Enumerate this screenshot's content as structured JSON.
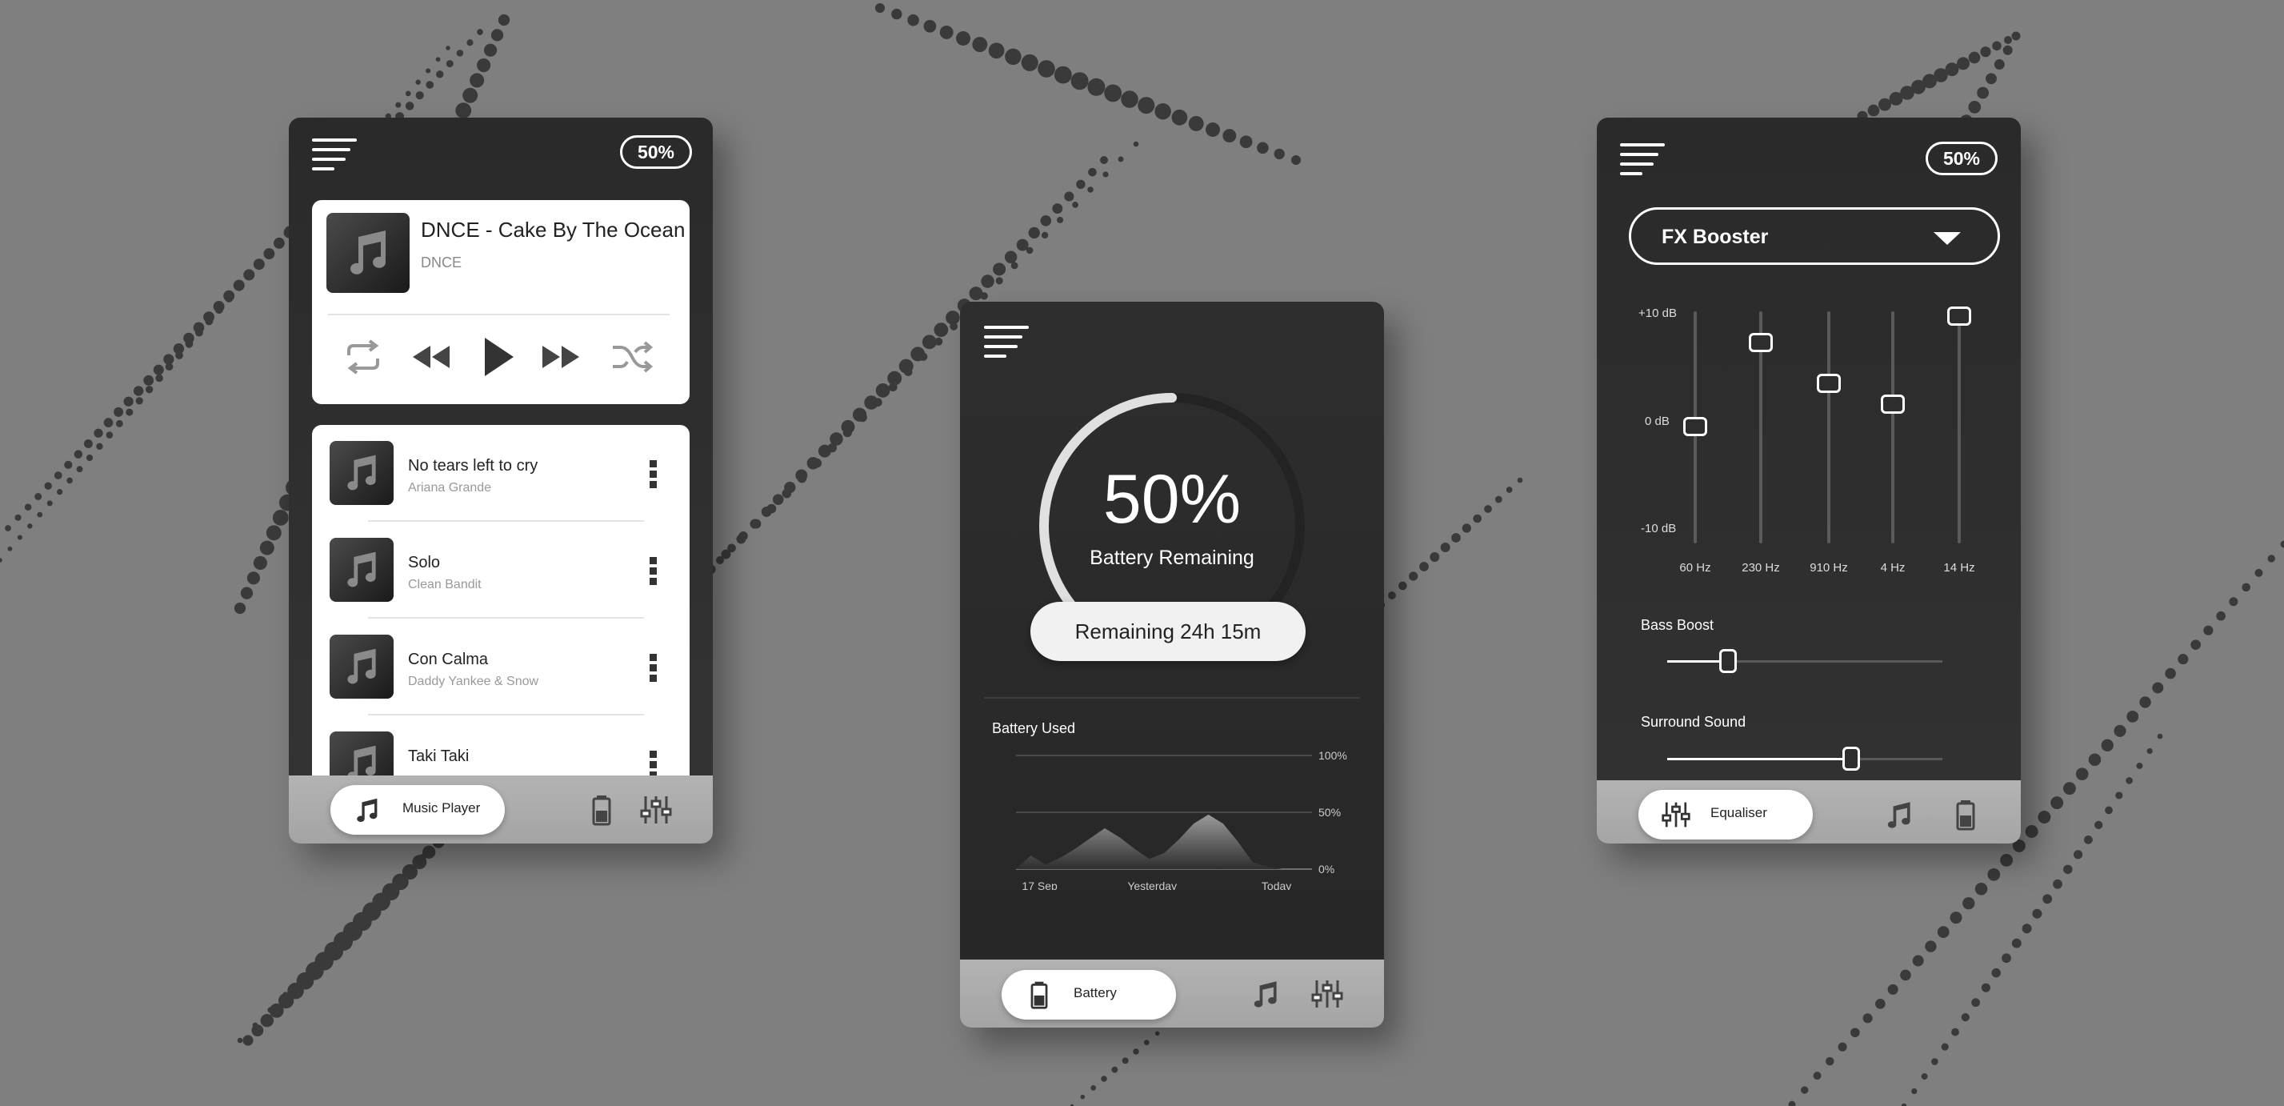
{
  "colors": {
    "background": "#7f7f7f",
    "phone_dark": "#2c2c2c",
    "bottom_bar": "#aaaaaa",
    "accent": "#ffffff"
  },
  "music_screen": {
    "battery_pill": "50%",
    "now_playing": {
      "title": "DNCE - Cake By The Ocean",
      "artist": "DNCE",
      "controls": [
        "repeat-icon",
        "rewind-icon",
        "play-icon",
        "fast-forward-icon",
        "shuffle-icon"
      ]
    },
    "tracks": [
      {
        "title": "No tears left to cry",
        "artist": "Ariana Grande"
      },
      {
        "title": "Solo",
        "artist": "Clean Bandit"
      },
      {
        "title": "Con Calma",
        "artist": "Daddy Yankee & Snow"
      },
      {
        "title": "Taki Taki",
        "artist": ""
      }
    ],
    "bottom_nav": {
      "active_label": "Music Player",
      "active_icon": "music-note-icon",
      "others": [
        "battery-icon",
        "equaliser-icon"
      ]
    }
  },
  "battery_screen": {
    "gauge_percent": "50%",
    "gauge_label": "Battery Remaining",
    "gauge_fraction": 0.5,
    "remaining_text": "Remaining 24h 15m",
    "chart_title": "Battery Used",
    "bottom_nav": {
      "active_label": "Battery",
      "active_icon": "battery-icon",
      "others": [
        "music-note-icon",
        "equaliser-icon"
      ]
    }
  },
  "chart_data": {
    "type": "area",
    "title": "Battery Used",
    "x_tick_labels": [
      "17 Sep",
      "Yesterday",
      "Today"
    ],
    "y_tick_labels": [
      "100%",
      "50%",
      "0%"
    ],
    "ylim": [
      0,
      100
    ],
    "x": [
      0,
      0.5,
      1,
      1.5,
      2,
      2.5,
      3,
      3.5,
      4,
      4.5,
      5,
      5.5,
      6,
      6.5,
      7,
      7.5,
      8,
      8.5,
      9,
      9.5,
      10
    ],
    "values": [
      0,
      12,
      4,
      10,
      18,
      27,
      36,
      28,
      18,
      9,
      14,
      26,
      40,
      48,
      40,
      24,
      6,
      2,
      0,
      0,
      0
    ],
    "grid": true
  },
  "eq_screen": {
    "battery_pill": "50%",
    "preset": "FX Booster",
    "db_labels": [
      "+10 dB",
      "0 dB",
      "-10 dB"
    ],
    "bands": [
      {
        "label": "60 Hz",
        "db": -0.2
      },
      {
        "label": "230 Hz",
        "db": 7.4
      },
      {
        "label": "910 Hz",
        "db": 3.7
      },
      {
        "label": "4 Hz",
        "db": 1.8
      },
      {
        "label": "14 Hz",
        "db": 9.8
      }
    ],
    "bass_boost": {
      "label": "Bass Boost",
      "value": 0.22
    },
    "surround_sound": {
      "label": "Surround Sound",
      "value": 0.67
    },
    "bottom_nav": {
      "active_label": "Equaliser",
      "active_icon": "equaliser-icon",
      "others": [
        "music-note-icon",
        "battery-icon"
      ]
    }
  }
}
